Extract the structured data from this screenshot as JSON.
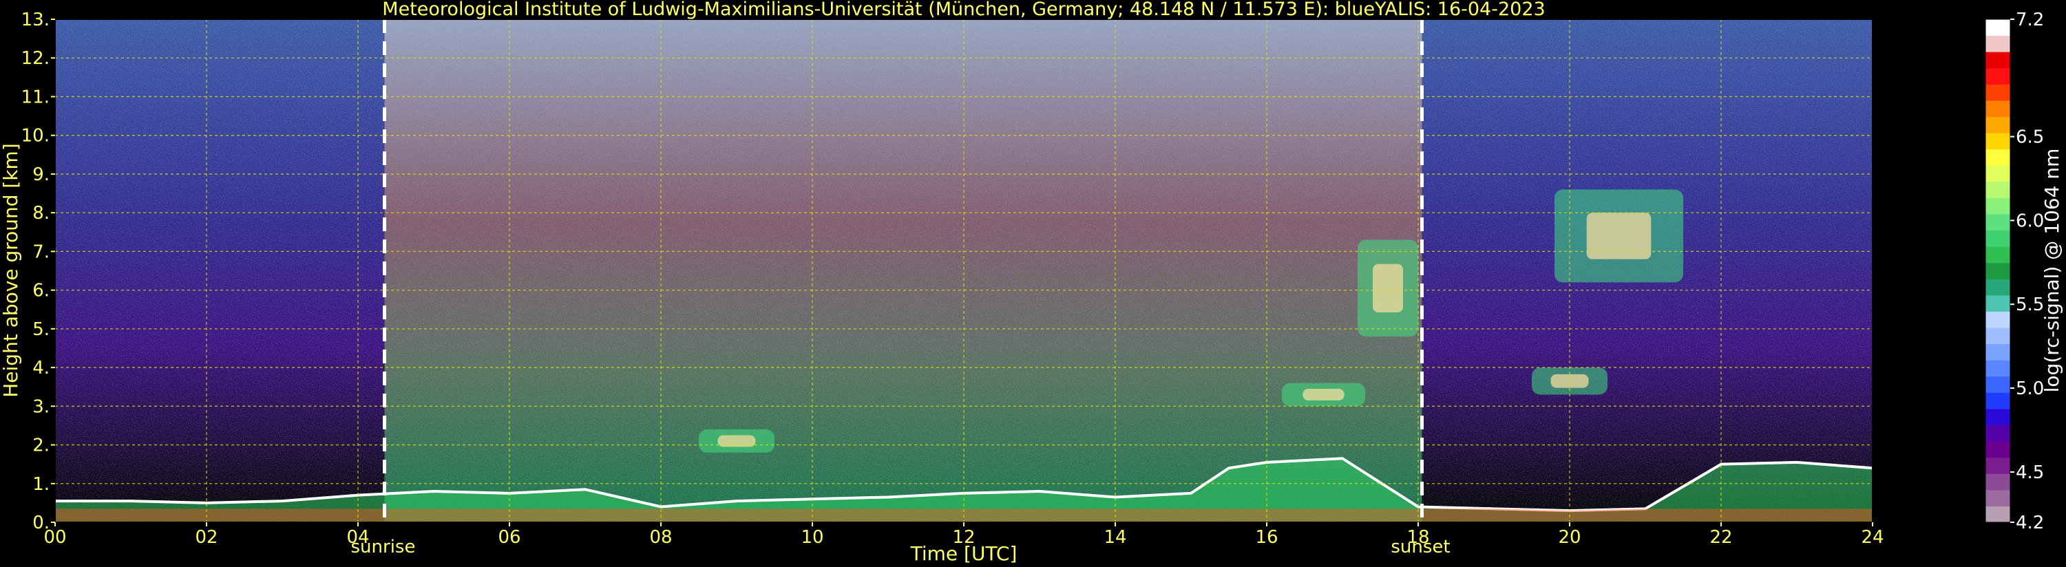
{
  "chart_data": {
    "type": "heatmap",
    "title": "Meteorological Institute of Ludwig-Maximilians-Universität (München, Germany; 48.148 N / 11.573 E):    blueYALIS: 16-04-2023",
    "xlabel": "Time [UTC]",
    "ylabel": "Height above ground [km]",
    "xlim": [
      0,
      24
    ],
    "ylim": [
      0,
      13
    ],
    "x_ticks": [
      "00",
      "02",
      "04",
      "06",
      "08",
      "10",
      "12",
      "14",
      "16",
      "18",
      "20",
      "22",
      "24"
    ],
    "y_ticks": [
      "0.",
      "1.",
      "2.",
      "3.",
      "4.",
      "5.",
      "6.",
      "7.",
      "8.",
      "9.",
      "10.",
      "11.",
      "12.",
      "13."
    ],
    "grid": true,
    "colorbar": {
      "label": "log(rc-signal) @ 1064 nm",
      "range": [
        4.2,
        7.2
      ],
      "tick_labels": [
        "4.2",
        "4.5",
        "5.0",
        "5.5",
        "6.0",
        "6.5",
        "7.2"
      ],
      "tick_values": [
        4.2,
        4.5,
        5.0,
        5.5,
        6.0,
        6.5,
        7.2
      ],
      "colors": [
        "#b7a0b4",
        "#9b6aa0",
        "#8d4a96",
        "#7a1d8f",
        "#6b0090",
        "#5400a8",
        "#2c08d8",
        "#1f3cff",
        "#3a66ff",
        "#5a86ff",
        "#7aa4ff",
        "#9ebeff",
        "#bcd6ff",
        "#4fc4b0",
        "#26a87a",
        "#1e9a40",
        "#2fc050",
        "#3fd070",
        "#5fe080",
        "#8cf07c",
        "#b8f870",
        "#e0ff5a",
        "#ffff40",
        "#ffd400",
        "#ffa800",
        "#ff8000",
        "#ff4000",
        "#ff1010",
        "#e80000",
        "#f0c8c8",
        "#ffffff"
      ]
    },
    "annotations": [
      {
        "label": "sunrise",
        "x": 4.35
      },
      {
        "label": "sunset",
        "x": 18.05
      }
    ],
    "features": {
      "boundary_layer_top_km": [
        [
          0,
          0.55
        ],
        [
          1,
          0.55
        ],
        [
          2,
          0.5
        ],
        [
          3,
          0.55
        ],
        [
          4,
          0.7
        ],
        [
          5,
          0.8
        ],
        [
          6,
          0.75
        ],
        [
          7,
          0.85
        ],
        [
          8,
          0.4
        ],
        [
          9,
          0.55
        ],
        [
          10,
          0.6
        ],
        [
          11,
          0.65
        ],
        [
          12,
          0.75
        ],
        [
          13,
          0.8
        ],
        [
          14,
          0.65
        ],
        [
          15,
          0.75
        ],
        [
          15.5,
          1.4
        ],
        [
          16,
          1.55
        ],
        [
          17,
          1.65
        ],
        [
          18,
          0.4
        ],
        [
          19,
          0.35
        ],
        [
          20,
          0.3
        ],
        [
          21,
          0.35
        ],
        [
          22,
          1.5
        ],
        [
          23,
          1.55
        ],
        [
          24,
          1.4
        ]
      ],
      "cloud_layers": [
        {
          "x": [
            16.2,
            17.3
          ],
          "y": [
            3.0,
            3.6
          ]
        },
        {
          "x": [
            17.2,
            18.0
          ],
          "y": [
            4.8,
            7.3
          ]
        },
        {
          "x": [
            19.5,
            20.5
          ],
          "y": [
            3.3,
            4.0
          ]
        },
        {
          "x": [
            19.8,
            21.5
          ],
          "y": [
            6.2,
            8.6
          ]
        },
        {
          "x": [
            8.5,
            9.5
          ],
          "y": [
            1.8,
            2.4
          ]
        }
      ]
    }
  }
}
